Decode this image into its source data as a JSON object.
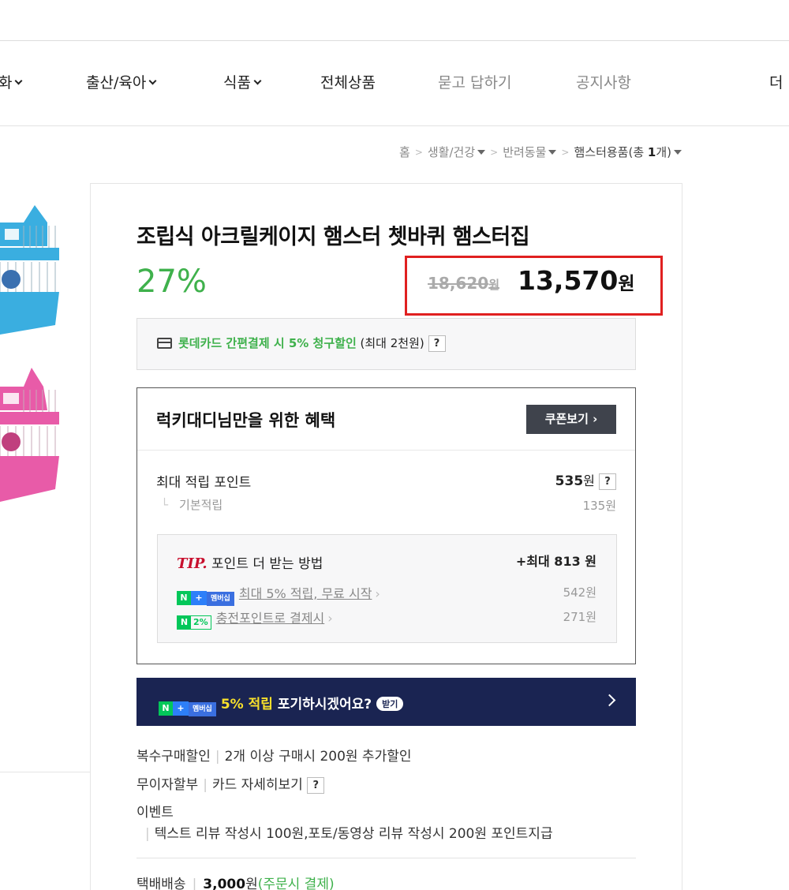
{
  "nav": {
    "items": [
      {
        "label": "화",
        "has_dropdown": true
      },
      {
        "label": "출산/육아",
        "has_dropdown": true
      },
      {
        "label": "식품",
        "has_dropdown": true
      },
      {
        "label": "전체상품",
        "has_dropdown": false
      },
      {
        "label": "묻고 답하기",
        "has_dropdown": false
      },
      {
        "label": "공지사항",
        "has_dropdown": false
      },
      {
        "label": "더",
        "has_dropdown": false
      }
    ]
  },
  "breadcrumb": {
    "home": "홈",
    "level1": "생활/건강",
    "level2": "반려동물",
    "current": "햄스터용품",
    "count_prefix": "(총 ",
    "count": "1",
    "count_suffix": "개)"
  },
  "product": {
    "title": "조립식 아크릴케이지 햄스터 쳇바퀴 햄스터집",
    "discount": "27%",
    "original_price": "18,620",
    "original_unit": "원",
    "sale_price": "13,570",
    "sale_unit": "원"
  },
  "card_promo": {
    "highlight": "롯데카드 간편결제 시 5% 청구할인",
    "note": " (최대 2천원) ",
    "help": "?"
  },
  "benefit": {
    "title": "럭키대디님만을 위한 혜택",
    "coupon_button": "쿠폰보기 ›",
    "max_points_label": "최대 적립 포인트",
    "max_points_value": "535",
    "max_points_unit": "원",
    "help": "?",
    "base_label": "기본적립",
    "base_value": "135원",
    "tip": {
      "tip_mark": "TIP.",
      "title": " 포인트 더 받는 방법",
      "max": "+최대 813 원",
      "rows": [
        {
          "badge": "N+멤버십",
          "text": "최대 5% 적립, 무료 시작",
          "amount": "542원"
        },
        {
          "badge": "N2%",
          "text": "충전포인트로 결제시",
          "amount": "271원"
        }
      ]
    }
  },
  "membership_banner": {
    "badge_n": "N",
    "badge_plus": "+",
    "badge_mem": "멤버십",
    "highlight": "5% 적립",
    "text": " 포기하시겠어요?",
    "pill": "받기"
  },
  "options": {
    "multi_label": "복수구매할인",
    "multi_value": "2개 이상 구매시 200원 추가할인",
    "installment_label": "무이자할부",
    "installment_value": "카드 자세히보기",
    "help": "?",
    "event_label": "이벤트",
    "event_value": "텍스트 리뷰 작성시 100원,포토/동영상 리뷰 작성시 200원 포인트지급",
    "shipping_label": "택배배송",
    "shipping_value": "3,000",
    "shipping_unit": "원",
    "shipping_note": "(주문시 결제)"
  },
  "colors": {
    "discount_green": "#3fb14c",
    "price_highlight_border": "#e02020",
    "banner_navy": "#1a2452",
    "banner_yellow": "#f8e02b",
    "cage_blue": "#3aaee0",
    "cage_pink": "#e85ba8"
  }
}
